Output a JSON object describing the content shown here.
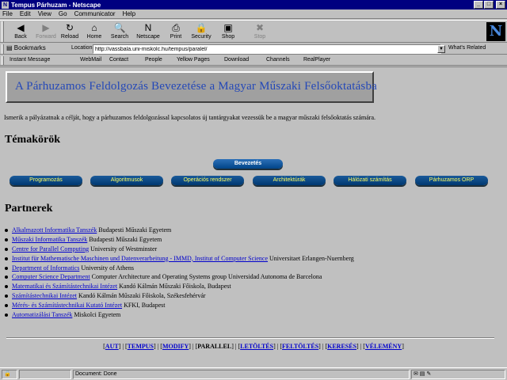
{
  "window": {
    "title": "Tempus Párhuzam - Netscape",
    "min": "_",
    "max": "□",
    "close": "×",
    "app_icon": "N"
  },
  "menu": [
    "File",
    "Edit",
    "View",
    "Go",
    "Communicator",
    "Help"
  ],
  "toolbar": {
    "buttons": [
      {
        "label": "Back",
        "glyph": "◀",
        "icon": "back-arrow-icon",
        "disabled": false
      },
      {
        "label": "Forward",
        "glyph": "▶",
        "icon": "forward-arrow-icon",
        "disabled": true
      },
      {
        "label": "Reload",
        "glyph": "↻",
        "icon": "reload-icon",
        "disabled": false
      },
      {
        "label": "Home",
        "glyph": "⌂",
        "icon": "home-icon",
        "disabled": false
      },
      {
        "label": "Search",
        "glyph": "🔍",
        "icon": "search-icon",
        "disabled": false
      },
      {
        "label": "Netscape",
        "glyph": "N",
        "icon": "netscape-icon",
        "disabled": false
      },
      {
        "label": "Print",
        "glyph": "⎙",
        "icon": "print-icon",
        "disabled": false
      },
      {
        "label": "Security",
        "glyph": "🔒",
        "icon": "lock-icon",
        "disabled": false
      },
      {
        "label": "Shop",
        "glyph": "▣",
        "icon": "shop-icon",
        "disabled": false
      },
      {
        "label": "Stop",
        "glyph": "✖",
        "icon": "stop-icon",
        "disabled": true
      }
    ],
    "logo": "N"
  },
  "location": {
    "bookmarks_label": "Bookmarks",
    "label": "Location:",
    "url": "http://vassbala.uni-miskolc.hu/tempus/paralel/",
    "related_label": "What's Related"
  },
  "personal_toolbar": [
    "Instant Message",
    "WebMail",
    "Contact",
    "People",
    "Yellow Pages",
    "Download",
    "Channels",
    "RealPlayer"
  ],
  "page": {
    "banner": "A Párhuzamos Feldolgozás Bevezetése a Magyar Műszaki Felsőoktatásba",
    "intro": "Ismerik a pályázatnak a célját, hogy a párhuzamos feldolgozással kapcsolatos új tantárgyakat vezessük be a magyar műszaki felsőoktatás számára.",
    "topics_heading": "Témakörök",
    "active_topic": "Bevezetés",
    "topics": [
      "Programozás",
      "Algoritmusok",
      "Operációs rendszer",
      "Architektúrák",
      "Hálózati számítás",
      "Párhuzamos ORP"
    ],
    "partners_heading": "Partnerek",
    "partners": [
      {
        "link": "Alkalmazott Informatika Tanszék",
        "text": " Budapesti Műszaki Egyetem"
      },
      {
        "link": "Műszaki Informatika Tanszék",
        "text": " Budapesti Műszaki Egyetem"
      },
      {
        "link": "Centre for Parallel Computing",
        "text": " University of Westminster"
      },
      {
        "link": "Institut für Mathematische Maschinen und Datenverarbeitung - IMMD, Institut of Computer Science",
        "text": " Universitaet Erlangen-Nuernberg"
      },
      {
        "link": "Department of Informatics",
        "text": " University of Athens"
      },
      {
        "link": "Computer Science Department",
        "text": " Computer Architecture and Operating Systems group Universidad Autonoma de Barcelona"
      },
      {
        "link": "Matematikai és Számítástechnikai Intézet",
        "text": " Kandó Kálmán Műszaki Főiskola, Budapest"
      },
      {
        "link": "Számítástechnikai Intézet",
        "text": " Kandó Kálmán Műszaki Főiskola, Székesfehérvár"
      },
      {
        "link": "Mérés- és Számítástechnikai Kutató Intézet",
        "text": " KFKI, Budapest"
      },
      {
        "link": "Automatizálási Tanszék",
        "text": " Miskolci Egyetem"
      }
    ],
    "footer": {
      "items": [
        {
          "label": "AUT",
          "current": false
        },
        {
          "label": "TEMPUS",
          "current": false
        },
        {
          "label": "MODIFY",
          "current": false
        },
        {
          "label": "PARALLEL",
          "current": true
        },
        {
          "label": "LETÖLTÉS",
          "current": false
        },
        {
          "label": "FELTÖLTÉS",
          "current": false
        },
        {
          "label": "KERESÉS",
          "current": false
        },
        {
          "label": "VÉLEMÉNY",
          "current": false
        }
      ]
    }
  },
  "status": {
    "text": "Document: Done"
  }
}
